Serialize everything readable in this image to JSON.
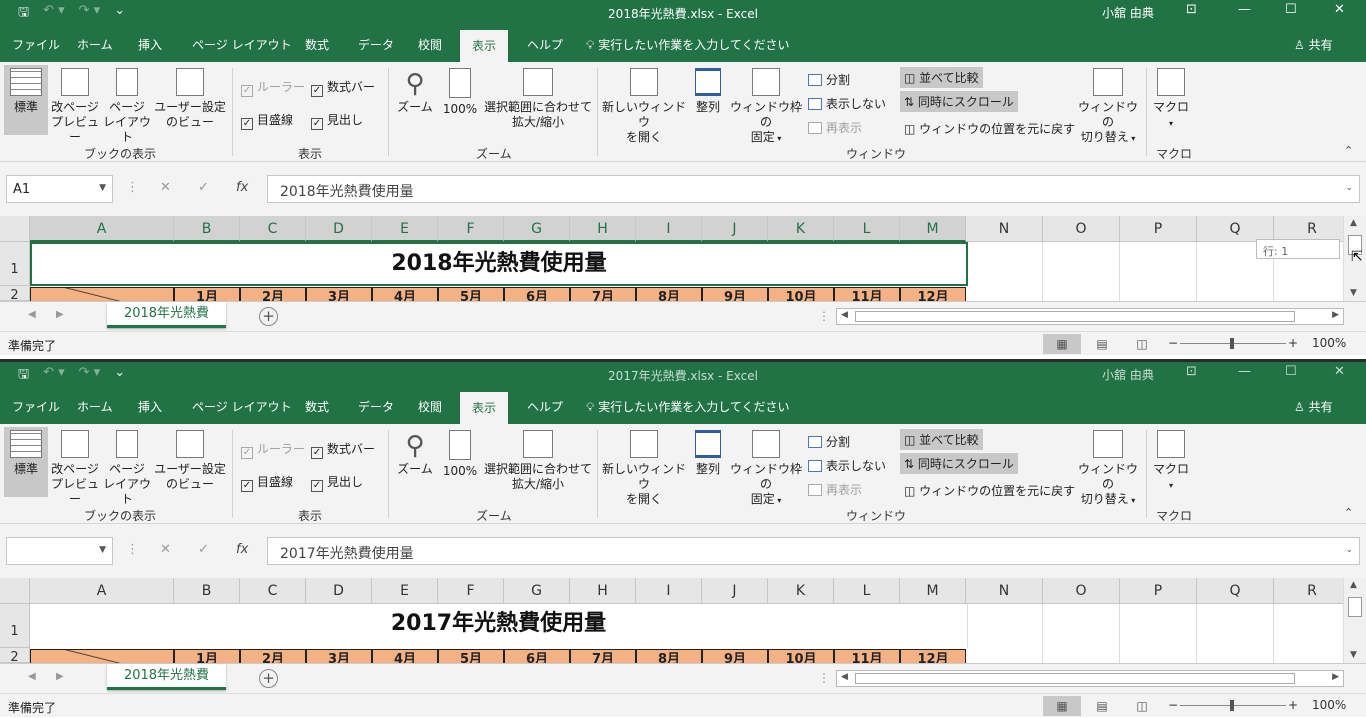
{
  "windows": [
    {
      "title": "2018年光熱費.xlsx  -  Excel",
      "user": "小舘 由典",
      "namebox": "A1",
      "formula": "2018年光熱費使用量",
      "cell_title": "2018年光熱費使用量",
      "sheet_tab": "2018年光熱費",
      "tooltip": "行: 1"
    },
    {
      "title": "2017年光熱費.xlsx  -  Excel",
      "user": "小舘 由典",
      "namebox": "",
      "formula": "2017年光熱費使用量",
      "cell_title": "2017年光熱費使用量",
      "sheet_tab": "2018年光熱費",
      "tooltip": ""
    }
  ],
  "tabs": [
    "ファイル",
    "ホーム",
    "挿入",
    "ページ レイアウト",
    "数式",
    "データ",
    "校閲",
    "表示",
    "ヘルプ"
  ],
  "active_tab": "表示",
  "tell_me": "実行したい作業を入力してください",
  "share": "共有",
  "ribbon": {
    "normal": "標準",
    "page_break_l1": "改ページ",
    "page_break_l2": "プレビュー",
    "page_layout_l1": "ページ",
    "page_layout_l2": "レイアウト",
    "custom_view_l1": "ユーザー設定",
    "custom_view_l2": "のビュー",
    "group_book_view": "ブックの表示",
    "ruler": "ルーラー",
    "formula_bar": "数式バー",
    "gridlines": "目盛線",
    "headings": "見出し",
    "group_show": "表示",
    "zoom": "ズーム",
    "zoom100": "100%",
    "zoom_sel_l1": "選択範囲に合わせて",
    "zoom_sel_l2": "拡大/縮小",
    "group_zoom": "ズーム",
    "new_window_l1": "新しいウィンドウ",
    "new_window_l2": "を開く",
    "arrange": "整列",
    "freeze_l1": "ウィンドウ枠の",
    "freeze_l2": "固定",
    "split": "分割",
    "hide": "表示しない",
    "unhide": "再表示",
    "side_by_side": "並べて比較",
    "sync_scroll": "同時にスクロール",
    "reset_pos": "ウィンドウの位置を元に戻す",
    "group_window": "ウィンドウ",
    "switch_l1": "ウィンドウの",
    "switch_l2": "切り替え",
    "macro": "マクロ",
    "group_macro": "マクロ"
  },
  "columns": [
    "A",
    "B",
    "C",
    "D",
    "E",
    "F",
    "G",
    "H",
    "I",
    "J",
    "K",
    "L",
    "M",
    "N",
    "O",
    "P",
    "Q",
    "R"
  ],
  "months": [
    "1月",
    "2月",
    "3月",
    "4月",
    "5月",
    "6月",
    "7月",
    "8月",
    "9月",
    "10月",
    "11月",
    "12月"
  ],
  "rows": [
    "1",
    "2"
  ],
  "status": "準備完了",
  "zoom_level": "100%",
  "colors": {
    "excel_green": "#217346",
    "month_fill": "#f4b183"
  }
}
